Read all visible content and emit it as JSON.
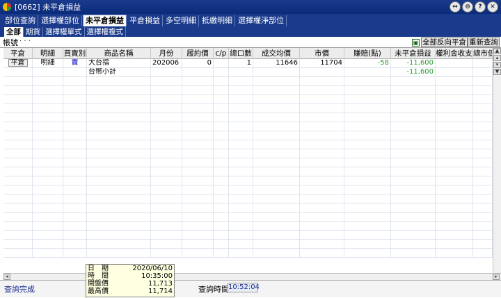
{
  "window": {
    "title": "[0662] 未平倉損益",
    "controls": [
      "↔",
      "⊖",
      "?",
      "✕"
    ]
  },
  "main_tabs": [
    {
      "label": "部位查詢",
      "active": false
    },
    {
      "label": "選擇權部位",
      "active": false
    },
    {
      "label": "未平倉損益",
      "active": true
    },
    {
      "label": "平倉損益",
      "active": false
    },
    {
      "label": "多空明細",
      "active": false
    },
    {
      "label": "抵繳明細",
      "active": false
    },
    {
      "label": "選擇權淨部位",
      "active": false
    }
  ],
  "sub_tabs": [
    {
      "label": "全部",
      "active": true
    },
    {
      "label": "期貨",
      "active": false
    },
    {
      "label": "選擇權單式",
      "active": false
    },
    {
      "label": "選擇權複式",
      "active": false
    }
  ],
  "account": {
    "label": "帳號",
    "value": "·  ·  ·",
    "reverse_button": "全部反向平倉",
    "requery_button": "重新查詢"
  },
  "table": {
    "headers": [
      "平倉",
      "明細",
      "買賣別",
      "商品名稱",
      "月份",
      "履約價",
      "c/p",
      "總口數",
      "成交均價",
      "市價",
      "賺賠(點)",
      "未平倉損益",
      "權利金收支",
      "總市值"
    ],
    "rows": [
      {
        "close_btn": "平倉",
        "detail_btn": "明細",
        "side": "賣",
        "product": "大台指",
        "month": "202006",
        "strike": "0",
        "cp": "",
        "qty": "1",
        "avg_price": "11646",
        "market": "11704",
        "pnl_pts": "-58",
        "unrealized": "-11,600",
        "premium": "",
        "market_value": ""
      },
      {
        "close_btn": "",
        "detail_btn": "",
        "side": "",
        "product": "台幣小計",
        "month": "",
        "strike": "",
        "cp": "",
        "qty": "",
        "avg_price": "",
        "market": "",
        "pnl_pts": "",
        "unrealized": "-11,600",
        "premium": "",
        "market_value": ""
      }
    ]
  },
  "status": {
    "message": "查詢完成",
    "query_time_label": "查詢時間",
    "query_time": "10:52:04"
  },
  "popup": [
    {
      "label": "日　期",
      "value": "2020/06/10"
    },
    {
      "label": "時　間",
      "value": "10:35:00"
    },
    {
      "label": "開盤價",
      "value": "11,713"
    },
    {
      "label": "最高價",
      "value": "11,714"
    }
  ]
}
